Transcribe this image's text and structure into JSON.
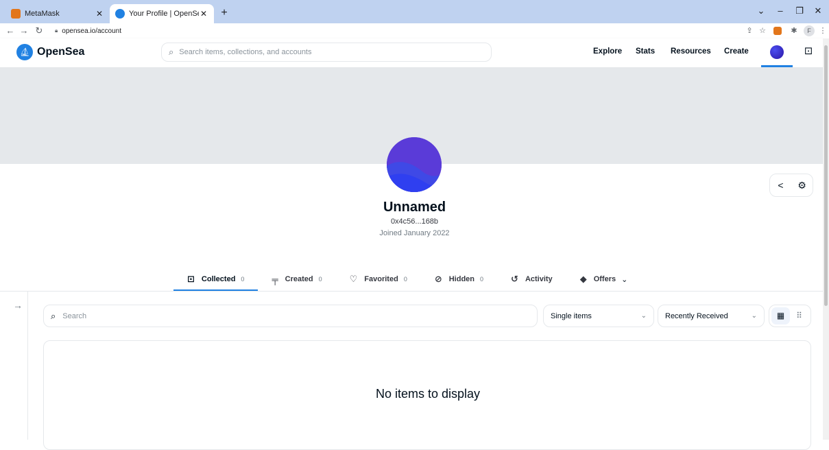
{
  "browser": {
    "tabs": [
      {
        "title": "MetaMask",
        "active": false
      },
      {
        "title": "Your Profile | OpenSea",
        "active": true
      }
    ],
    "url": "opensea.io/account",
    "profile_initial": "F"
  },
  "header": {
    "brand": "OpenSea",
    "search_placeholder": "Search items, collections, and accounts",
    "nav": [
      "Explore",
      "Stats",
      "Resources",
      "Create"
    ]
  },
  "profile": {
    "name": "Unnamed",
    "address": "0x4c56...168b",
    "joined": "Joined January 2022"
  },
  "tabs": [
    {
      "label": "Collected",
      "count": "0",
      "icon": "collected-icon"
    },
    {
      "label": "Created",
      "count": "0",
      "icon": "paintbrush-icon"
    },
    {
      "label": "Favorited",
      "count": "0",
      "icon": "heart-icon"
    },
    {
      "label": "Hidden",
      "count": "0",
      "icon": "eye-off-icon"
    },
    {
      "label": "Activity",
      "count": "",
      "icon": "history-icon"
    },
    {
      "label": "Offers",
      "count": "",
      "icon": "tag-icon"
    }
  ],
  "filters": {
    "search_placeholder": "Search",
    "item_type": "Single items",
    "sort": "Recently Received"
  },
  "empty_message": "No items to display",
  "colors": {
    "accent": "#2081e2",
    "banner": "#e5e8eb",
    "avatar": "#5a3bd8"
  }
}
